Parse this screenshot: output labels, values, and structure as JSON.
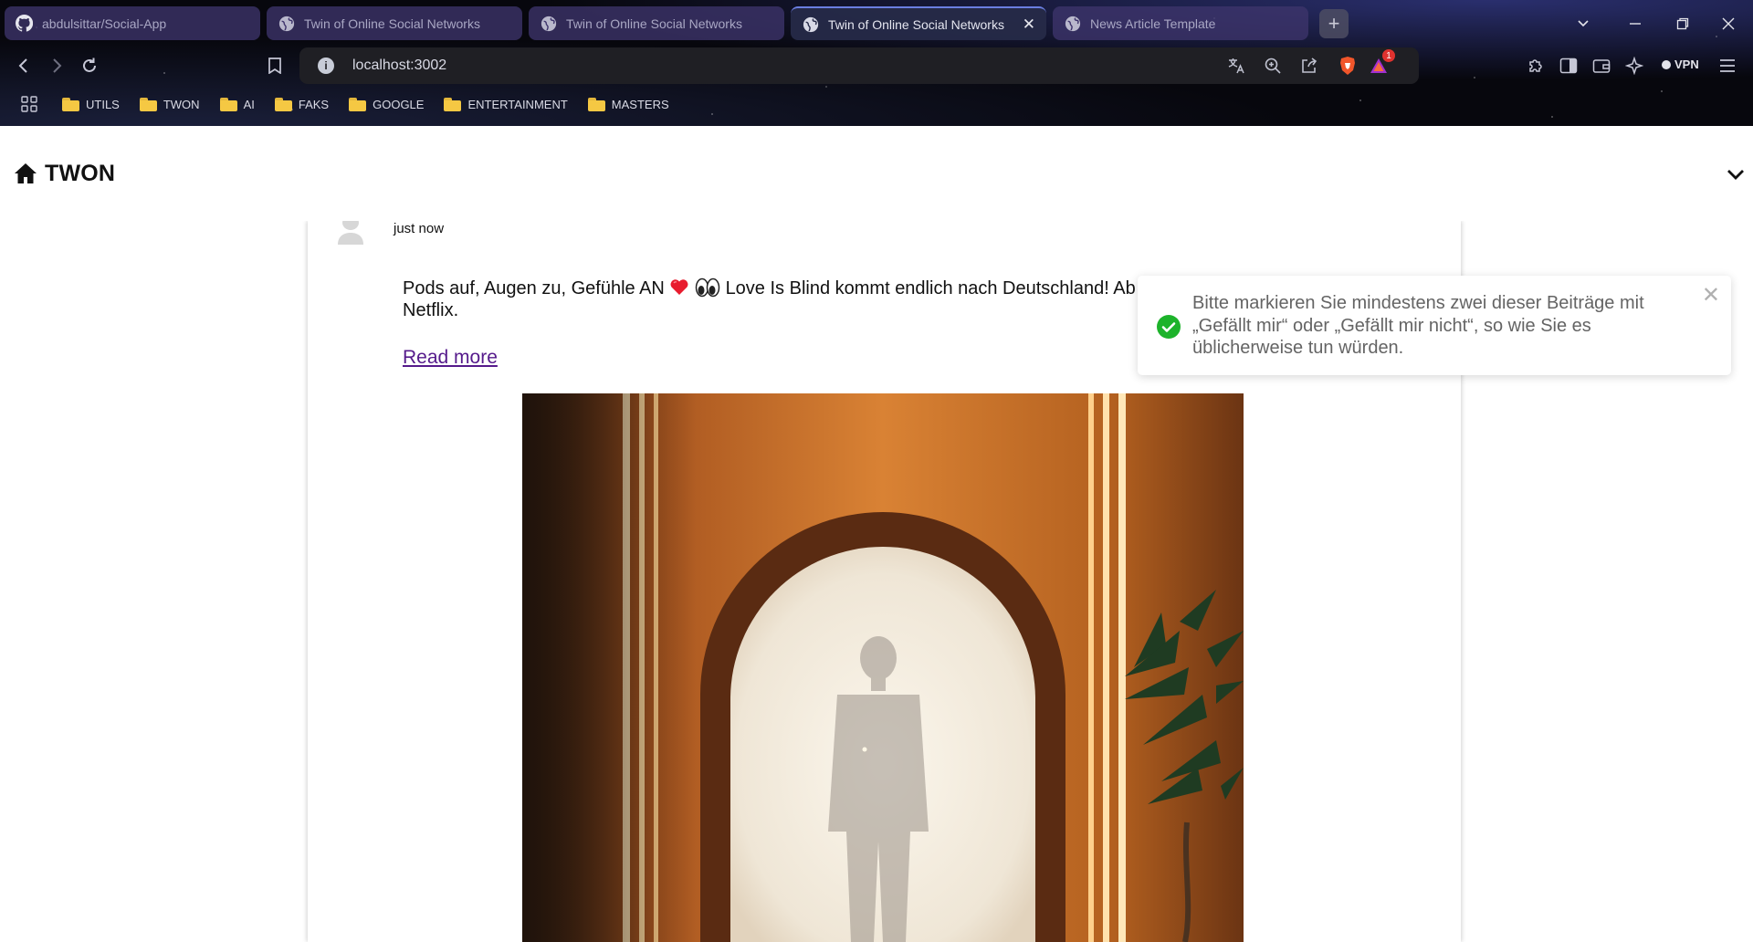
{
  "browser": {
    "tabs": [
      {
        "title": "abdulsittar/Social-App",
        "icon": "github-icon",
        "active": false
      },
      {
        "title": "Twin of Online Social Networks",
        "icon": "globe-icon",
        "active": false
      },
      {
        "title": "Twin of Online Social Networks",
        "icon": "globe-icon",
        "active": false
      },
      {
        "title": "Twin of Online Social Networks",
        "icon": "globe-icon",
        "active": true
      },
      {
        "title": "News Article Template",
        "icon": "globe-icon",
        "active": false
      }
    ],
    "url": "localhost:3002",
    "notification_count": "1",
    "vpn_label": "VPN",
    "bookmarks": [
      "UTILS",
      "TWON",
      "AI",
      "FAKS",
      "GOOGLE",
      "ENTERTAINMENT",
      "MASTERS"
    ]
  },
  "app": {
    "title": "TWON"
  },
  "post": {
    "timestamp": "just now",
    "text_before": "Pods auf, Augen zu, Gefühle AN",
    "text_after": "Love Is Blind kommt endlich nach Deutschland! Ab 3. Januar, nur auf Netflix.",
    "read_more": "Read more"
  },
  "toast": {
    "message": "Bitte markieren Sie mindestens zwei dieser Beiträge mit „Gefällt mir“ oder „Gefällt mir nicht“, so wie Sie es üblicherweise tun würden.",
    "close": "✕"
  },
  "colors": {
    "toast_success": "#1db32b",
    "link_visited": "#551a8b",
    "active_tab_accent": "#6a7ee0"
  }
}
